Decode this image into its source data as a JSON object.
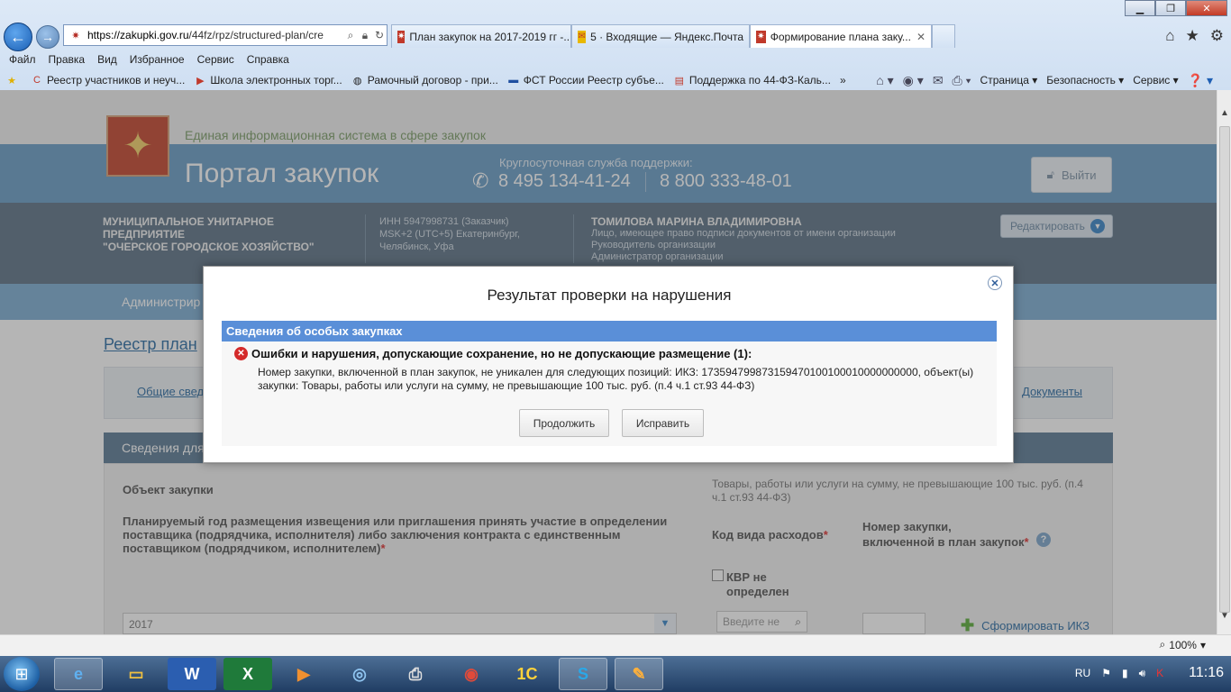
{
  "browser": {
    "url_domain": "https://zakupki.gov.ru",
    "url_path": "/44fz/rpz/structured-plan/cre",
    "tabs": [
      {
        "label": "План закупок на 2017-2019 гг -..."
      },
      {
        "label": "5 · Входящие — Яндекс.Почта"
      },
      {
        "label": "Формирование плана заку..."
      }
    ],
    "tab_close": "✕",
    "window_controls": {
      "minimize": "▁",
      "maximize": "❐",
      "close": "✕"
    },
    "menu": [
      "Файл",
      "Правка",
      "Вид",
      "Избранное",
      "Сервис",
      "Справка"
    ],
    "favorites": [
      {
        "label": "Реестр участников и неуч..."
      },
      {
        "label": "Школа электронных торг..."
      },
      {
        "label": "Рамочный договор - при..."
      },
      {
        "label": "ФСТ России  Реестр субъе..."
      },
      {
        "label": "Поддержка по 44-ФЗ-Каль..."
      }
    ],
    "more_chevron": "»",
    "command_bar": {
      "page": "Страница",
      "safety": "Безопасность",
      "tools": "Сервис"
    },
    "zoom": "100%"
  },
  "site": {
    "eis_title": "Единая информационная система в сфере закупок",
    "portal_title": "Портал закупок",
    "support_label": "Круглосуточная служба поддержки:",
    "phone1": "8 495 134-41-24",
    "phone2": "8 800 333-48-01",
    "logout": "Выйти"
  },
  "org": {
    "name_line1": "МУНИЦИПАЛЬНОЕ УНИТАРНОЕ ПРЕДПРИЯТИЕ",
    "name_line2": "\"ОЧЕРСКОЕ ГОРОДСКОЕ ХОЗЯЙСТВО\"",
    "inn": "ИНН 5947998731 (Заказчик)",
    "tz_line1": "MSK+2 (UTC+5) Екатеринбург,",
    "tz_line2": "Челябинск, Уфа",
    "person": "ТОМИЛОВА МАРИНА ВЛАДИМИРОВНА",
    "roles": [
      "Лицо, имеющее право подписи документов от имени организации",
      "Руководитель организации",
      "Администратор организации"
    ],
    "edit": "Редактировать"
  },
  "nav": {
    "admin": "Администрир"
  },
  "page": {
    "breadcrumb": "Реестр план",
    "tab_general": "Общие свед",
    "tab_docs": "Документы",
    "section_title": "Сведения для",
    "object_label": "Объект закупки",
    "object_value": "Товары, работы или услуги на сумму, не превышающие 100 тыс. руб. (п.4 ч.1 ст.93 44-ФЗ)",
    "year_label": "Планируемый год размещения извещения или приглашения принять участие в определении поставщика (подрядчика, исполнителя) либо заключения контракта с единственным поставщиком (подрядчиком, исполнителем)",
    "required_mark": "*",
    "kod_label": "Код вида расходов",
    "num_label_line1": "Номер закупки,",
    "num_label_line2": "включенной в план закупок",
    "kvr_label": "КВР не определен",
    "year_value": "2017",
    "kod_placeholder": "Введите не",
    "form_ikz": "Сформировать ИКЗ"
  },
  "modal": {
    "title": "Результат проверки на нарушения",
    "bar": "Сведения об особых закупках",
    "error_head": "Ошибки и нарушения, допускающие сохранение, но не допускающие размещение (1):",
    "error_text": "Номер закупки, включенной в план закупок, не уникален для следующих позиций: ИКЗ: 173594799873159470100100010000000000, объект(ы) закупки: Товары, работы или услуги на сумму, не превышающие 100 тыс. руб. (п.4 ч.1 ст.93 44-ФЗ)",
    "continue": "Продолжить",
    "fix": "Исправить"
  },
  "taskbar": {
    "lang": "RU",
    "time": "11:16"
  },
  "colors": {
    "modal_bar": "#5a8fd8",
    "header_blue": "#6b9ec7",
    "org_band": "#5f7588",
    "error_red": "#d42a2a"
  }
}
